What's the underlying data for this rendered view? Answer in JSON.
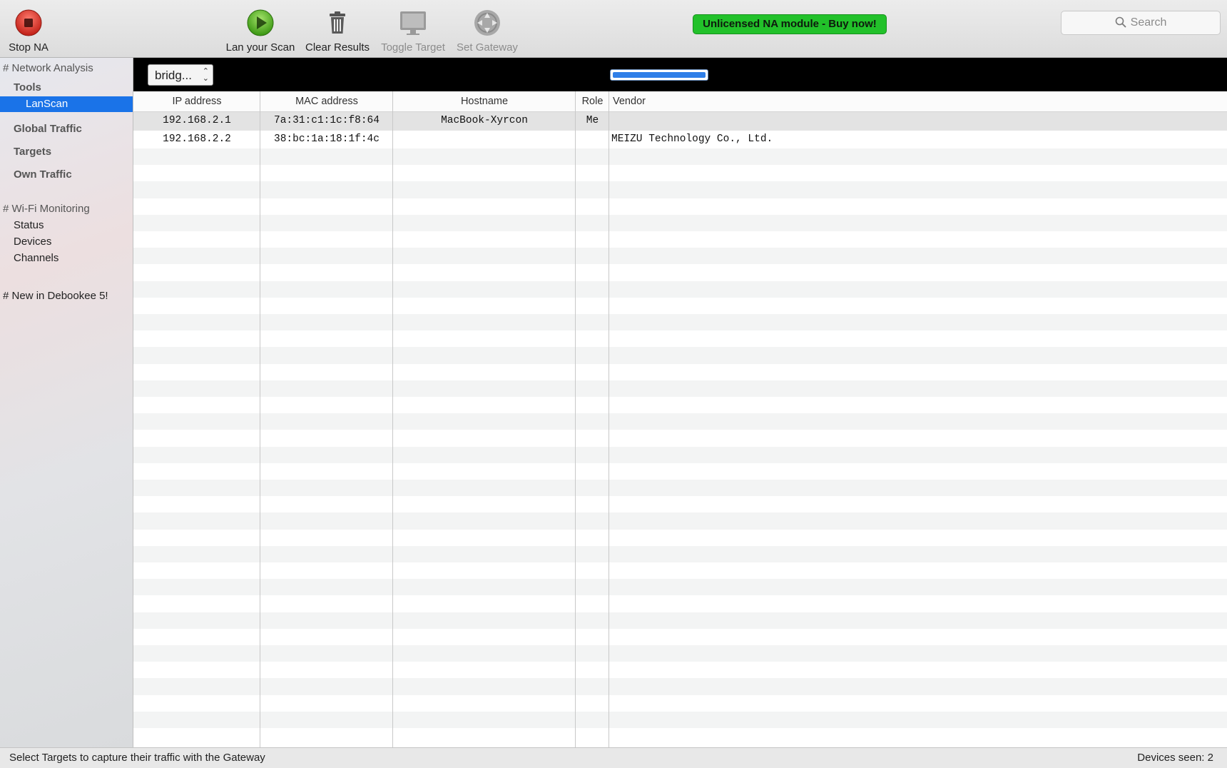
{
  "toolbar": {
    "stop_label": "Stop NA",
    "scan_label": "Lan your Scan",
    "clear_label": "Clear Results",
    "toggle_label": "Toggle Target",
    "gateway_label": "Set Gateway",
    "buy_label": "Unlicensed NA module - Buy now!",
    "search_placeholder": "Search",
    "icons": {
      "stop": "stop-icon",
      "scan": "play-icon",
      "clear": "trash-icon",
      "toggle": "monitor-icon",
      "gateway": "gateway-icon",
      "search": "search-icon"
    }
  },
  "sidebar": {
    "network_header": "Network Analysis",
    "tools_label": "Tools",
    "lanscan_label": "LanScan",
    "global_traffic": "Global Traffic",
    "targets": "Targets",
    "own_traffic": "Own Traffic",
    "wifi_header": "Wi-Fi Monitoring",
    "status": "Status",
    "devices": "Devices",
    "channels": "Channels",
    "new_in": "New in Debookee 5!"
  },
  "main": {
    "interface_select": "bridg...",
    "columns": {
      "ip": "IP address",
      "mac": "MAC address",
      "hostname": "Hostname",
      "role": "Role",
      "vendor": "Vendor"
    },
    "rows": [
      {
        "ip": "192.168.2.1",
        "mac": "7a:31:c1:1c:f8:64",
        "hostname": "MacBook-Xyrcon",
        "role": "Me",
        "vendor": ""
      },
      {
        "ip": "192.168.2.2",
        "mac": "38:bc:1a:18:1f:4c",
        "hostname": "",
        "role": "",
        "vendor": "MEIZU Technology Co., Ltd."
      }
    ]
  },
  "status": {
    "hint": "Select Targets to capture their traffic with the Gateway",
    "devices_seen": "Devices seen: 2"
  },
  "colors": {
    "accent": "#1a73e8",
    "buy_badge": "#22c12a",
    "stop_red": "#d9342b",
    "scan_green": "#4caf20"
  }
}
